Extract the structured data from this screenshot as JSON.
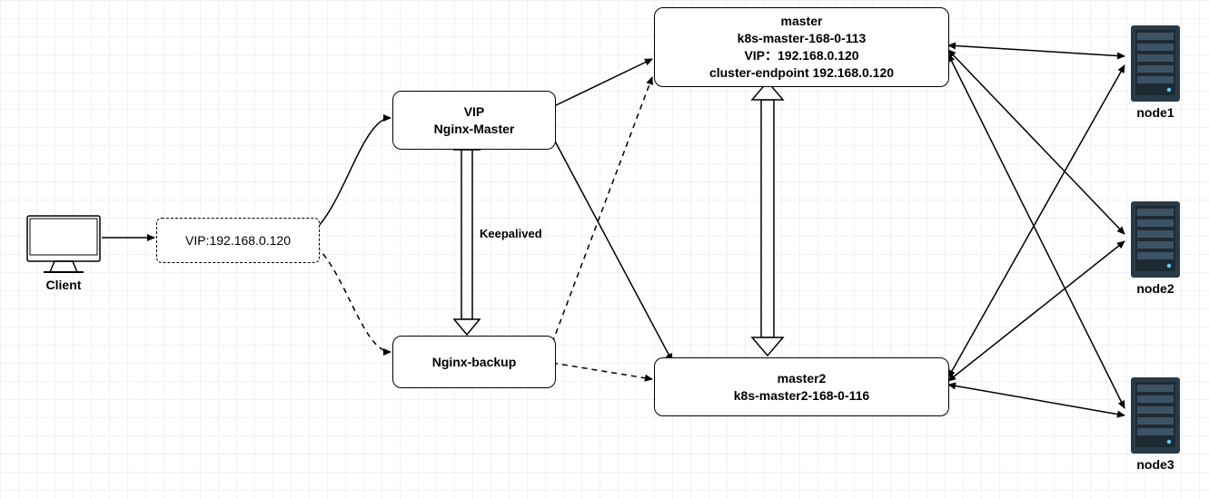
{
  "client": {
    "label": "Client"
  },
  "vip_box": {
    "label": "VIP:192.168.0.120"
  },
  "nginx_master": {
    "line1": "VIP",
    "line2": "Nginx-Master"
  },
  "keepalived": {
    "label": "Keepalived"
  },
  "nginx_backup": {
    "label": "Nginx-backup"
  },
  "master": {
    "line1": "master",
    "line2": "k8s-master-168-0-113",
    "line3": "VIP：192.168.0.120",
    "line4": "cluster-endpoint  192.168.0.120"
  },
  "master2": {
    "line1": "master2",
    "line2": "k8s-master2-168-0-116"
  },
  "nodes": {
    "n1": "node1",
    "n2": "node2",
    "n3": "node3"
  }
}
